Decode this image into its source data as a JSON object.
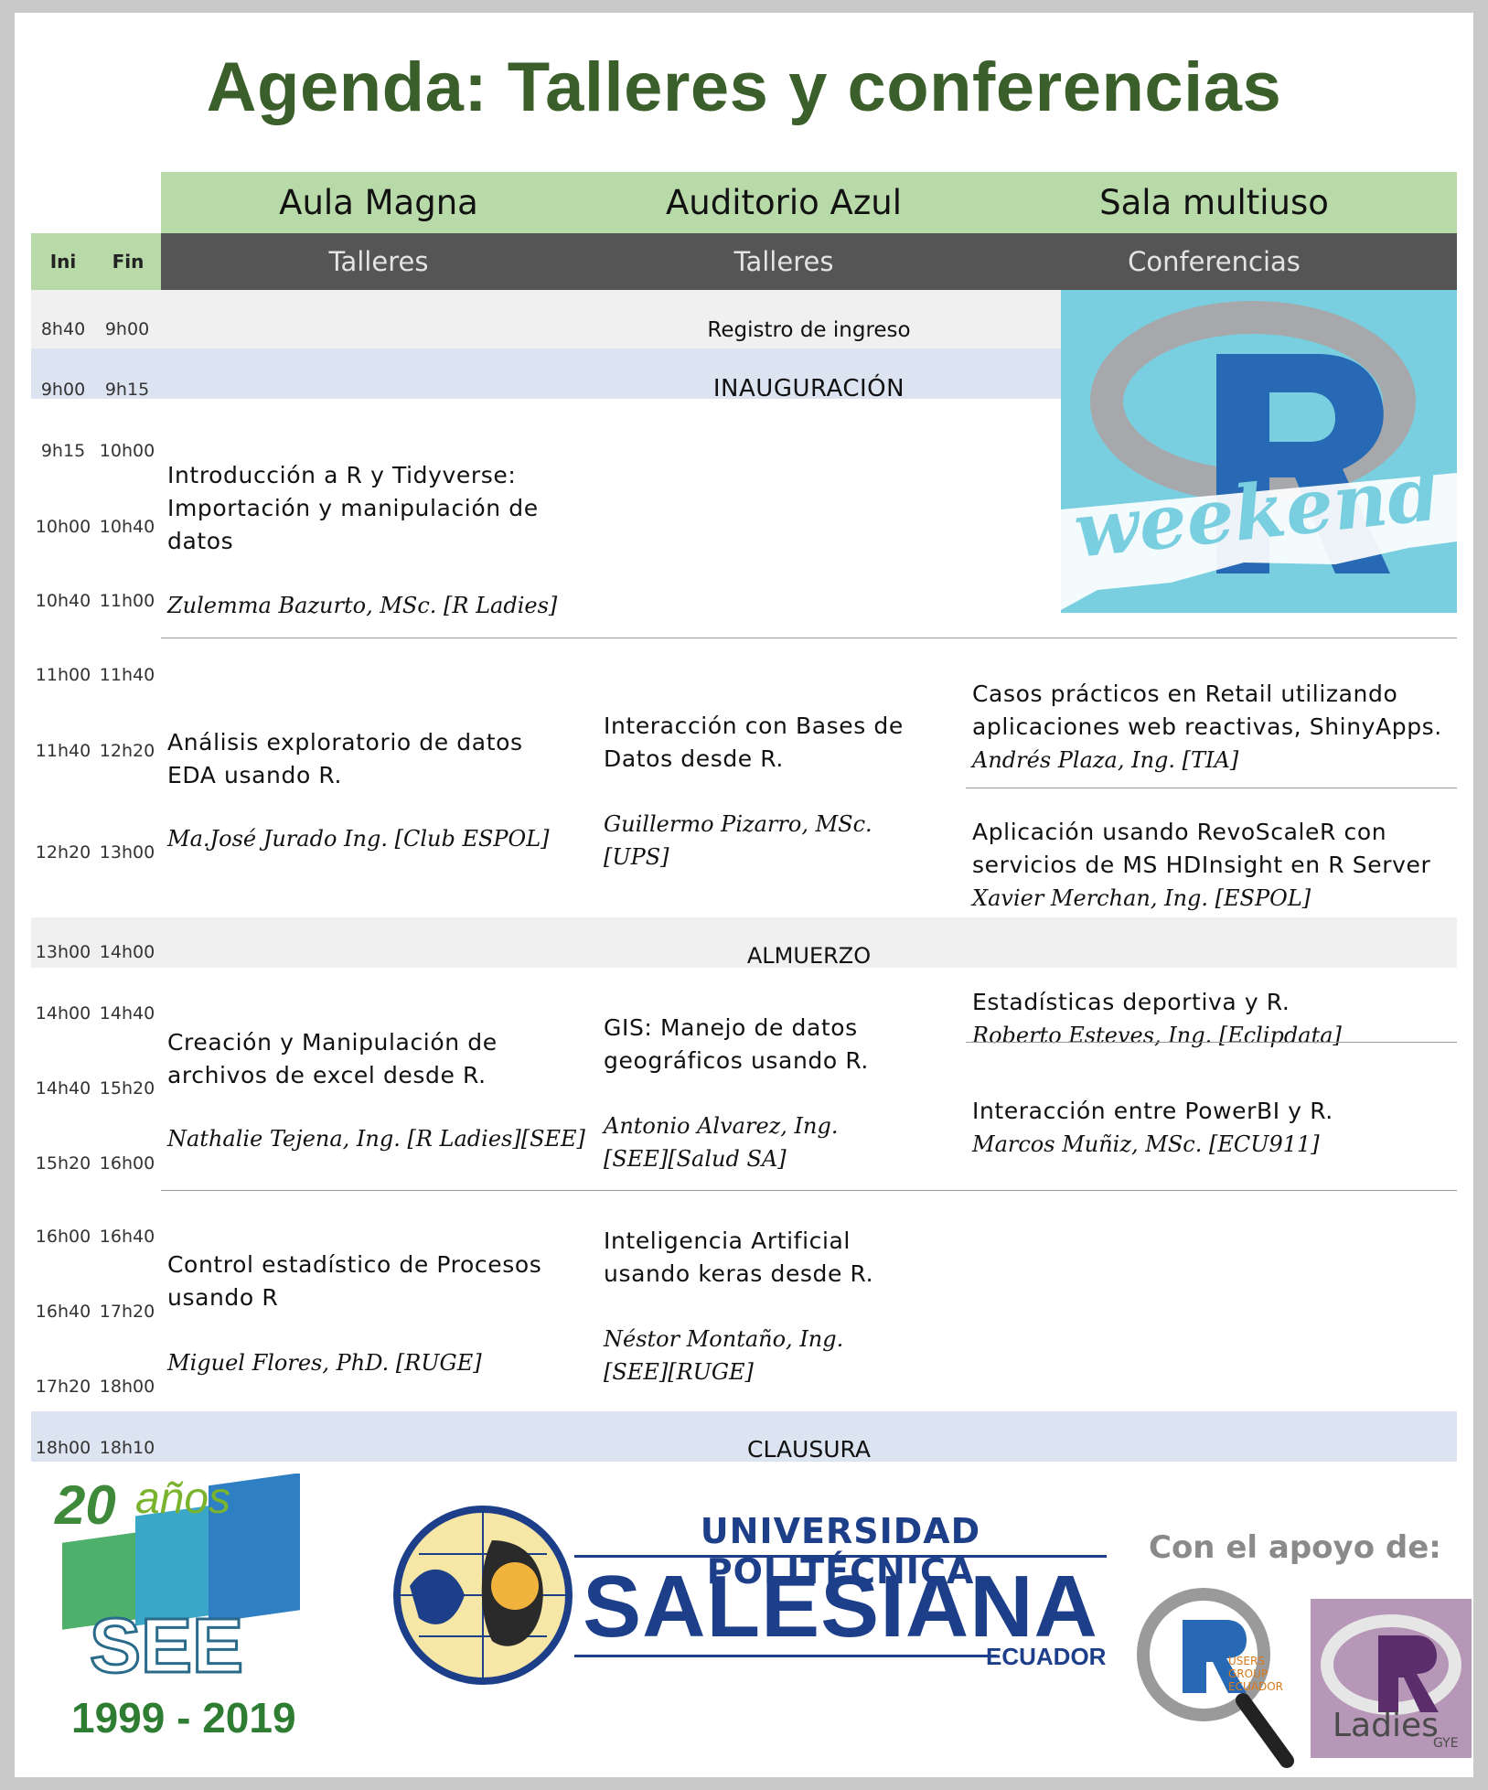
{
  "title": "Agenda: Talleres y conferencias",
  "header": {
    "ini": "Ini",
    "fin": "Fin",
    "venues": [
      "Aula Magna",
      "Auditorio Azul",
      "Sala multiuso"
    ],
    "types": [
      "Talleres",
      "Talleres",
      "Conferencias"
    ]
  },
  "times": [
    [
      "8h40",
      "9h00"
    ],
    [
      "9h00",
      "9h15"
    ],
    [
      "9h15",
      "10h00"
    ],
    [
      "10h00",
      "10h40"
    ],
    [
      "10h40",
      "11h00"
    ],
    [
      "11h00",
      "11h40"
    ],
    [
      "11h40",
      "12h20"
    ],
    [
      "12h20",
      "13h00"
    ],
    [
      "13h00",
      "14h00"
    ],
    [
      "14h00",
      "14h40"
    ],
    [
      "14h40",
      "15h20"
    ],
    [
      "15h20",
      "16h00"
    ],
    [
      "16h00",
      "16h40"
    ],
    [
      "16h40",
      "17h20"
    ],
    [
      "17h20",
      "18h00"
    ],
    [
      "18h00",
      "18h10"
    ]
  ],
  "events": {
    "registro": "Registro de ingreso",
    "inauguracion": "INAUGURACIÓN",
    "almuerzo": "ALMUERZO",
    "clausura": "CLAUSURA"
  },
  "sessions": {
    "b1_aula_title": "Introducción a R y Tidyverse: Importación y manipulación de datos",
    "b1_aula_speaker": "Zulemma Bazurto, MSc. [R Ladies]",
    "b2_aula_title": "Análisis exploratorio de datos EDA usando R.",
    "b2_aula_speaker": "Ma.José Jurado Ing. [Club ESPOL]",
    "b2_azul_title": "Interacción con Bases de Datos desde R.",
    "b2_azul_speaker": "Guillermo Pizarro, MSc. [UPS]",
    "b2_sala1_title": "Casos prácticos en Retail utilizando aplicaciones web reactivas, ShinyApps.",
    "b2_sala1_speaker": "Andrés Plaza, Ing. [TIA]",
    "b2_sala2_title": "Aplicación usando RevoScaleR con servicios de MS HDInsight en R Server",
    "b2_sala2_speaker": "Xavier Merchan, Ing. [ESPOL]",
    "b3_aula_title": "Creación y Manipulación de archivos de excel desde R.",
    "b3_aula_speaker": "Nathalie Tejena, Ing. [R Ladies][SEE]",
    "b3_azul_title": "GIS: Manejo de datos geográficos usando R.",
    "b3_azul_speaker": "Antonio Alvarez, Ing. [SEE][Salud SA]",
    "b3_sala1_title": "Estadísticas deportiva y R.",
    "b3_sala1_speaker": "Roberto Esteves, Ing. [Eclipdata]",
    "b3_sala2_title": "Interacción entre PowerBI y R.",
    "b3_sala2_speaker": "Marcos Muñiz, MSc. [ECU911]",
    "b4_aula_title": "Control estadístico de Procesos usando R",
    "b4_aula_speaker": "Miguel Flores, PhD. [RUGE]",
    "b4_azul_title": "Inteligencia Artificial usando keras desde R.",
    "b4_azul_speaker": "Néstor Montaño, Ing. [SEE][RUGE]"
  },
  "logos": {
    "rweekend_word": "weekend",
    "see_years": "20",
    "see_anos": "años",
    "see_name": "SEE",
    "see_range": "1999 - 2019",
    "ups_line1": "UNIVERSIDAD POLITÉCNICA",
    "ups_line2": "SALESIANA",
    "ups_line3": "ECUADOR",
    "apoyo": "Con el apoyo de:",
    "rug_text": "USERS GROUP ECUADOR",
    "rladies_text": "Ladies",
    "rladies_city": "GYE"
  },
  "colors": {
    "title_green": "#3a5f2a",
    "venue_green": "#b8d9a8",
    "type_gray": "#555555",
    "row_gray": "#f0f0f0",
    "row_blue": "#dce3f1",
    "rweekend_bg": "#79cfe0",
    "r_blue": "#2769b4"
  }
}
